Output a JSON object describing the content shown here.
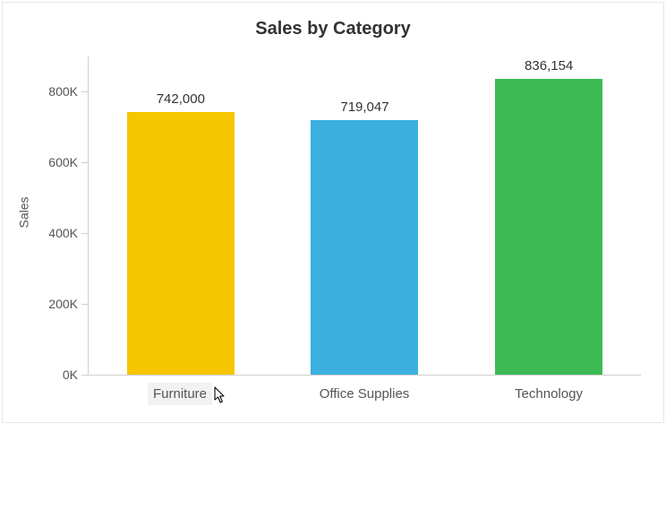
{
  "chart_data": {
    "type": "bar",
    "title": "Sales by Category",
    "ylabel": "Sales",
    "xlabel": "",
    "categories": [
      "Furniture",
      "Office Supplies",
      "Technology"
    ],
    "values": [
      742000,
      719047,
      836154
    ],
    "value_labels": [
      "742,000",
      "719,047",
      "836,154"
    ],
    "colors": [
      "#f6c600",
      "#3bb0e0",
      "#3cba54"
    ],
    "ylim": [
      0,
      900000
    ],
    "yticks": [
      0,
      200000,
      400000,
      600000,
      800000
    ],
    "ytick_labels": [
      "0K",
      "200K",
      "400K",
      "600K",
      "800K"
    ],
    "hovered_category_index": 0
  },
  "cursor": {
    "x_pct": 32,
    "y_label_area": true
  }
}
